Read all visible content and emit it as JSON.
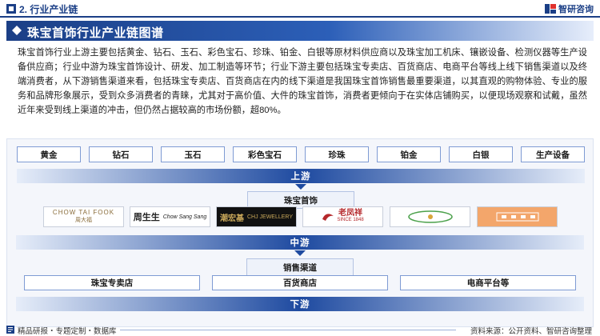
{
  "header": {
    "section": "2. 行业产业链",
    "brand": "智研咨询"
  },
  "title": "珠宝首饰行业产业链图谱",
  "paragraph": "珠宝首饰行业上游主要包括黄金、钻石、玉石、彩色宝石、珍珠、铂金、白银等原材料供应商以及珠宝加工机床、镶嵌设备、检测仪器等生产设备供应商；行业中游为珠宝首饰设计、研发、加工制造等环节；行业下游主要包括珠宝专卖店、百货商店、电商平台等线上线下销售渠道以及终端消费者，从下游销售渠道来看，包括珠宝专卖店、百货商店在内的线下渠道是我国珠宝首饰销售最重要渠道，以其直观的购物体验、专业的服务和品牌形象展示，受到众多消费者的青睐，尤其对于高价值、大件的珠宝首饰，消费者更倾向于在实体店铺购买，以便现场观察和试戴，虽然近年来受到线上渠道的冲击，但仍然占据较高的市场份额，超80%。",
  "upstream": {
    "items": [
      "黄金",
      "钻石",
      "玉石",
      "彩色宝石",
      "珍珠",
      "铂金",
      "白银",
      "生产设备"
    ],
    "label": "上游"
  },
  "midstream": {
    "tag": "珠宝首饰",
    "label": "中游",
    "logos": [
      {
        "main": "CHOW TAI FOOK",
        "sub": "周大福"
      },
      {
        "main": "周生生",
        "sub": "Chow Sang Sang"
      },
      {
        "main": "潮宏基",
        "sub": "CHJ JEWELLERY"
      },
      {
        "main": "老凤祥",
        "sub": "SINCE 1848"
      },
      {
        "main": "",
        "sub": ""
      },
      {
        "main": "",
        "sub": ""
      }
    ]
  },
  "downstream": {
    "tag": "销售渠道",
    "channels": [
      "珠宝专卖店",
      "百货商店",
      "电商平台等"
    ],
    "label": "下游"
  },
  "footer": {
    "left": "精品研报・专题定制・数据库",
    "right": "资料来源：公开资料、智研咨询整理"
  },
  "colors": {
    "primary": "#1b3f86",
    "accent": "#1e4aa0",
    "panel": "#f4f6fb"
  }
}
